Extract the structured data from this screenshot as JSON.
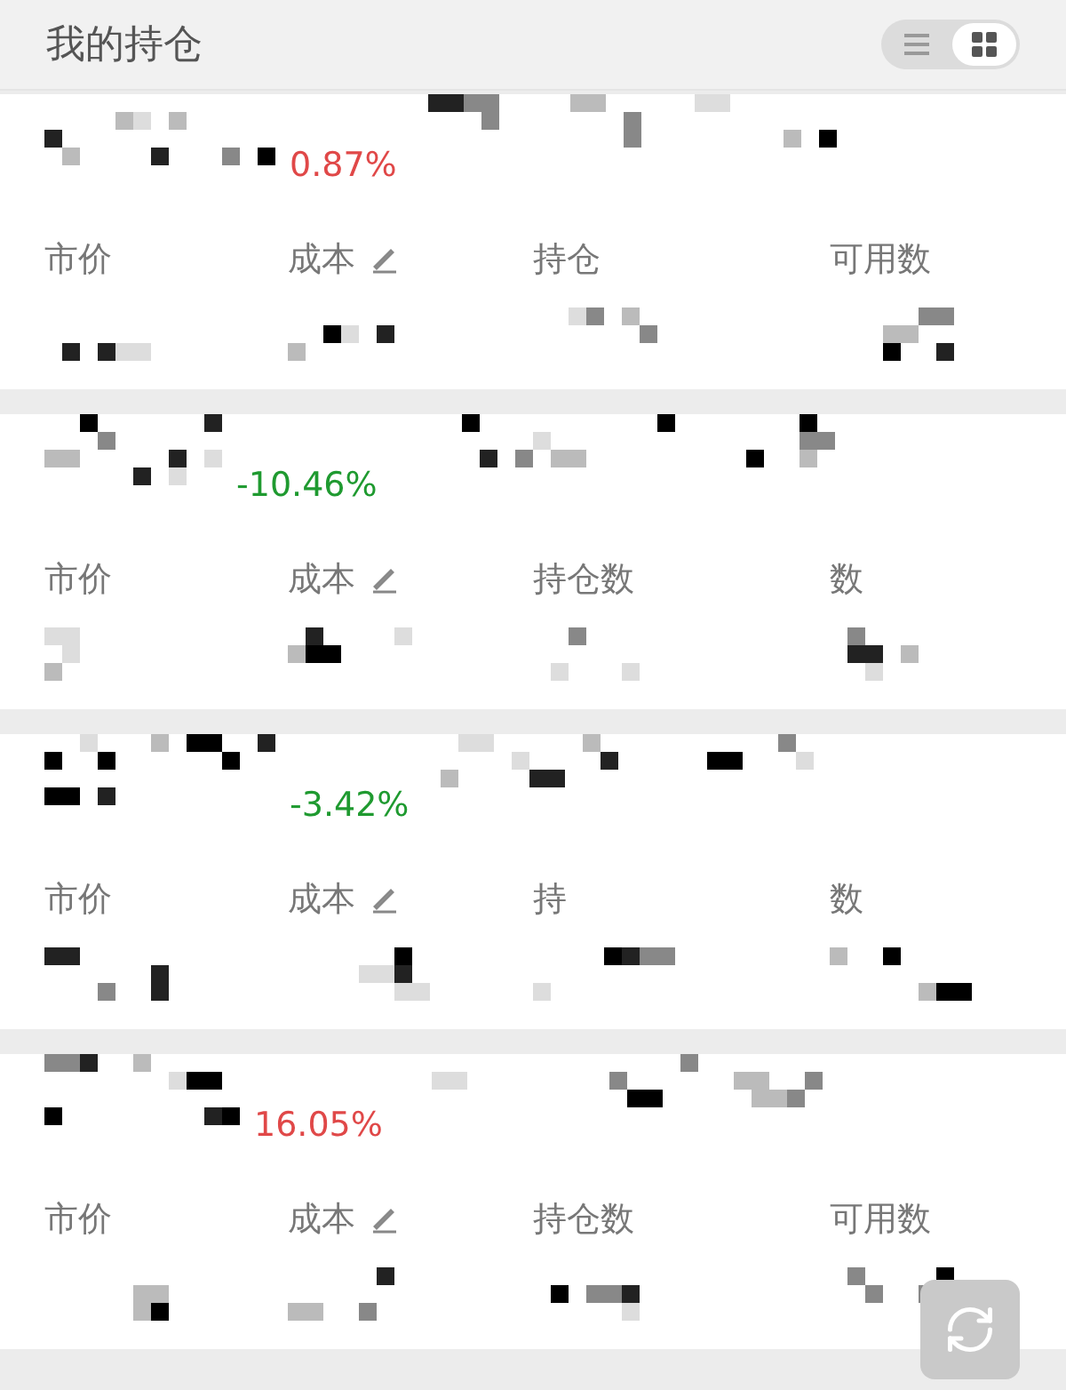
{
  "header": {
    "title": "我的持仓"
  },
  "view_toggle": [
    {
      "kind": "list",
      "selected": false
    },
    {
      "kind": "grid",
      "selected": true
    }
  ],
  "positions": [
    {
      "change": "0.87%",
      "color": "#e04848",
      "labels": [
        "市价",
        "成本",
        "持仓",
        "可用数"
      ]
    },
    {
      "change": "-10.46%",
      "color": "#1f9a30",
      "labels": [
        "市价",
        "成本",
        "持仓数",
        "数"
      ]
    },
    {
      "change": "-3.42%",
      "color": "#1f9a30",
      "labels": [
        "市价",
        "成本",
        "持",
        "数"
      ]
    },
    {
      "change": "16.05%",
      "color": "#e04848",
      "labels": [
        "市价",
        "成本",
        "持仓数",
        "可用数"
      ]
    }
  ]
}
